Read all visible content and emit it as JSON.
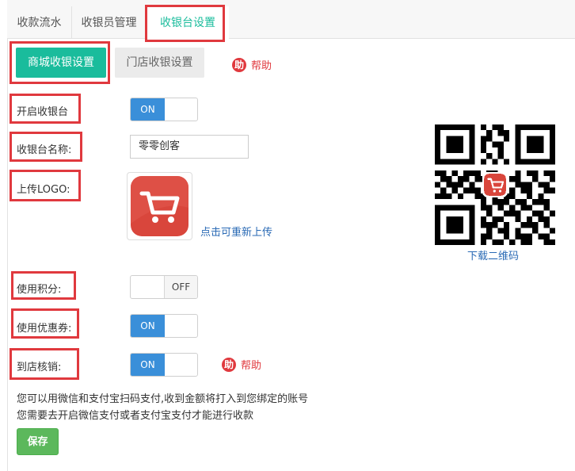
{
  "top_tabs": [
    {
      "label": "收款流水"
    },
    {
      "label": "收银员管理"
    },
    {
      "label": "收银台设置"
    }
  ],
  "sub_tabs": [
    {
      "label": "商城收银设置"
    },
    {
      "label": "门店收银设置"
    }
  ],
  "help": {
    "icon_char": "助",
    "label": "帮助"
  },
  "form": {
    "enable_cashier": {
      "label": "开启收银台",
      "state": "ON"
    },
    "cashier_name": {
      "label": "收银台名称:",
      "value": "零零创客"
    },
    "upload_logo": {
      "label": "上传LOGO:",
      "reupload_link": "点击可重新上传"
    },
    "use_points": {
      "label": "使用积分:",
      "state": "OFF"
    },
    "use_coupons": {
      "label": "使用优惠券:",
      "state": "ON"
    },
    "store_verify": {
      "label": "到店核销:",
      "state": "ON"
    }
  },
  "qr": {
    "download_label": "下载二维码"
  },
  "info": {
    "line1": "您可以用微信和支付宝扫码支付,收到金额将打入到您绑定的账号",
    "line2": "您需要去开启微信支付或者支付宝支付才能进行收款"
  },
  "save_label": "保存",
  "colors": {
    "accent": "#1abc9c",
    "toggle_on": "#3a8fd9",
    "highlight": "#e0393e",
    "save": "#5cb85c",
    "link": "#2a6ab5"
  }
}
